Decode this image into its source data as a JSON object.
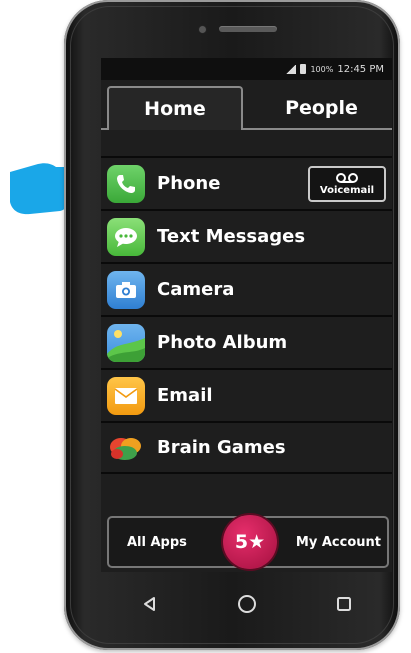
{
  "status_bar": {
    "battery": "100%",
    "time": "12:45 PM"
  },
  "tabs": [
    {
      "label": "Home",
      "active": true
    },
    {
      "label": "People",
      "active": false
    }
  ],
  "apps": [
    {
      "label": "Phone",
      "icon": "phone-icon"
    },
    {
      "label": "Text Messages",
      "icon": "message-bubble-icon"
    },
    {
      "label": "Camera",
      "icon": "camera-icon"
    },
    {
      "label": "Photo Album",
      "icon": "photo-album-icon"
    },
    {
      "label": "Email",
      "icon": "envelope-icon"
    },
    {
      "label": "Brain Games",
      "icon": "brain-games-icon"
    }
  ],
  "voicemail_button": {
    "label": "Voicemail",
    "icon": "voicemail-icon"
  },
  "bottom_bar": {
    "left_label": "All Apps",
    "badge_label": "5★",
    "right_label": "My Account"
  },
  "nav_icons": [
    "back-icon",
    "home-circle-icon",
    "recents-square-icon"
  ],
  "colors": {
    "screen_bg": "#1e1e1e",
    "badge": "#c01a53",
    "pointer_hand": "#1aa7e8",
    "phone_icon": "#4cc24a",
    "messages_icon": "#5fcf4a",
    "camera_icon": "#3a8fdf",
    "email_icon": "#f6a81c"
  }
}
